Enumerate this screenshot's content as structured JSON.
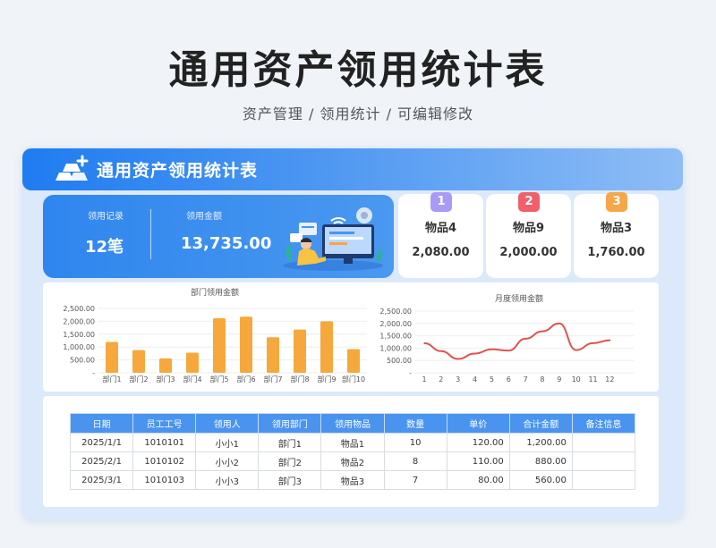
{
  "header": {
    "title": "通用资产领用统计表",
    "subtitle": "资产管理 /  领用统计 /  可编辑修改"
  },
  "banner": {
    "title": "通用资产领用统计表"
  },
  "summary": {
    "records_label": "领用记录",
    "records_value": "12笔",
    "amount_label": "领用金额",
    "amount_value": "13,735.00"
  },
  "ranking": [
    {
      "rank": "1",
      "name": "物品4",
      "value": "2,080.00",
      "color": "#a99bf5"
    },
    {
      "rank": "2",
      "name": "物品9",
      "value": "2,000.00",
      "color": "#f0606a"
    },
    {
      "rank": "3",
      "name": "物品3",
      "value": "1,760.00",
      "color": "#f5a74a"
    }
  ],
  "chart_data": [
    {
      "type": "bar",
      "title": "部门领用金额",
      "categories": [
        "部门1",
        "部门2",
        "部门3",
        "部门4",
        "部门5",
        "部门6",
        "部门7",
        "部门8",
        "部门9",
        "部门10"
      ],
      "values": [
        1200,
        880,
        560,
        780,
        2120,
        2180,
        1380,
        1680,
        2000,
        920
      ],
      "y_ticks": [
        "2,500.00",
        "2,000.00",
        "1,500.00",
        "1,000.00",
        "500.00",
        "-"
      ],
      "ylim": [
        0,
        2500
      ],
      "color": "#f6a83c"
    },
    {
      "type": "line",
      "title": "月度领用金额",
      "categories": [
        "1",
        "2",
        "3",
        "4",
        "5",
        "6",
        "7",
        "8",
        "9",
        "10",
        "11",
        "12"
      ],
      "values": [
        1200,
        880,
        560,
        780,
        950,
        900,
        1380,
        1680,
        2000,
        920,
        1200,
        1320
      ],
      "y_ticks": [
        "2,500.00",
        "2,000.00",
        "1,500.00",
        "1,000.00",
        "500.00",
        "-"
      ],
      "ylim": [
        0,
        2500
      ],
      "color": "#e0534d"
    }
  ],
  "table": {
    "columns": [
      "日期",
      "员工工号",
      "领用人",
      "领用部门",
      "领用物品",
      "数量",
      "单价",
      "合计金额",
      "备注信息"
    ],
    "rows": [
      [
        "2025/1/1",
        "1010101",
        "小小1",
        "部门1",
        "物品1",
        "10",
        "120.00",
        "1,200.00",
        ""
      ],
      [
        "2025/2/1",
        "1010102",
        "小小2",
        "部门2",
        "物品2",
        "8",
        "110.00",
        "880.00",
        ""
      ],
      [
        "2025/3/1",
        "1010103",
        "小小3",
        "部门3",
        "物品3",
        "7",
        "80.00",
        "560.00",
        ""
      ]
    ]
  }
}
